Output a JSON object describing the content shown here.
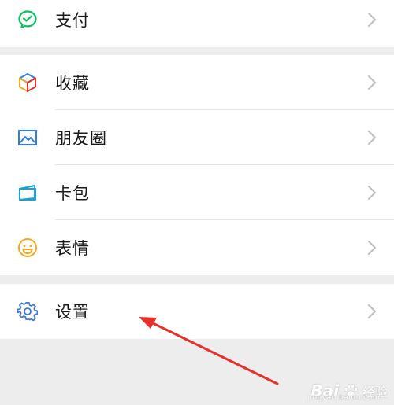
{
  "menu": {
    "pay": {
      "label": "支付",
      "icon": "wechat-pay-icon"
    },
    "favorites": {
      "label": "收藏",
      "icon": "cube-icon"
    },
    "moments": {
      "label": "朋友圈",
      "icon": "image-icon"
    },
    "cards": {
      "label": "卡包",
      "icon": "card-wallet-icon"
    },
    "stickers": {
      "label": "表情",
      "icon": "smiley-icon"
    },
    "settings": {
      "label": "设置",
      "icon": "gear-icon"
    }
  },
  "watermark": {
    "logo": "Bai",
    "logo2": "经验",
    "sub": "jingyan.baidu.com"
  },
  "colors": {
    "pay_green": "#07C160",
    "moments_blue": "#2D7DF0",
    "cards_teal": "#16A1D8",
    "sticker_orange": "#F6A623",
    "settings_blue": "#3E76D9",
    "annotation_red": "#E8302A",
    "chevron": "#BDBDBD"
  }
}
